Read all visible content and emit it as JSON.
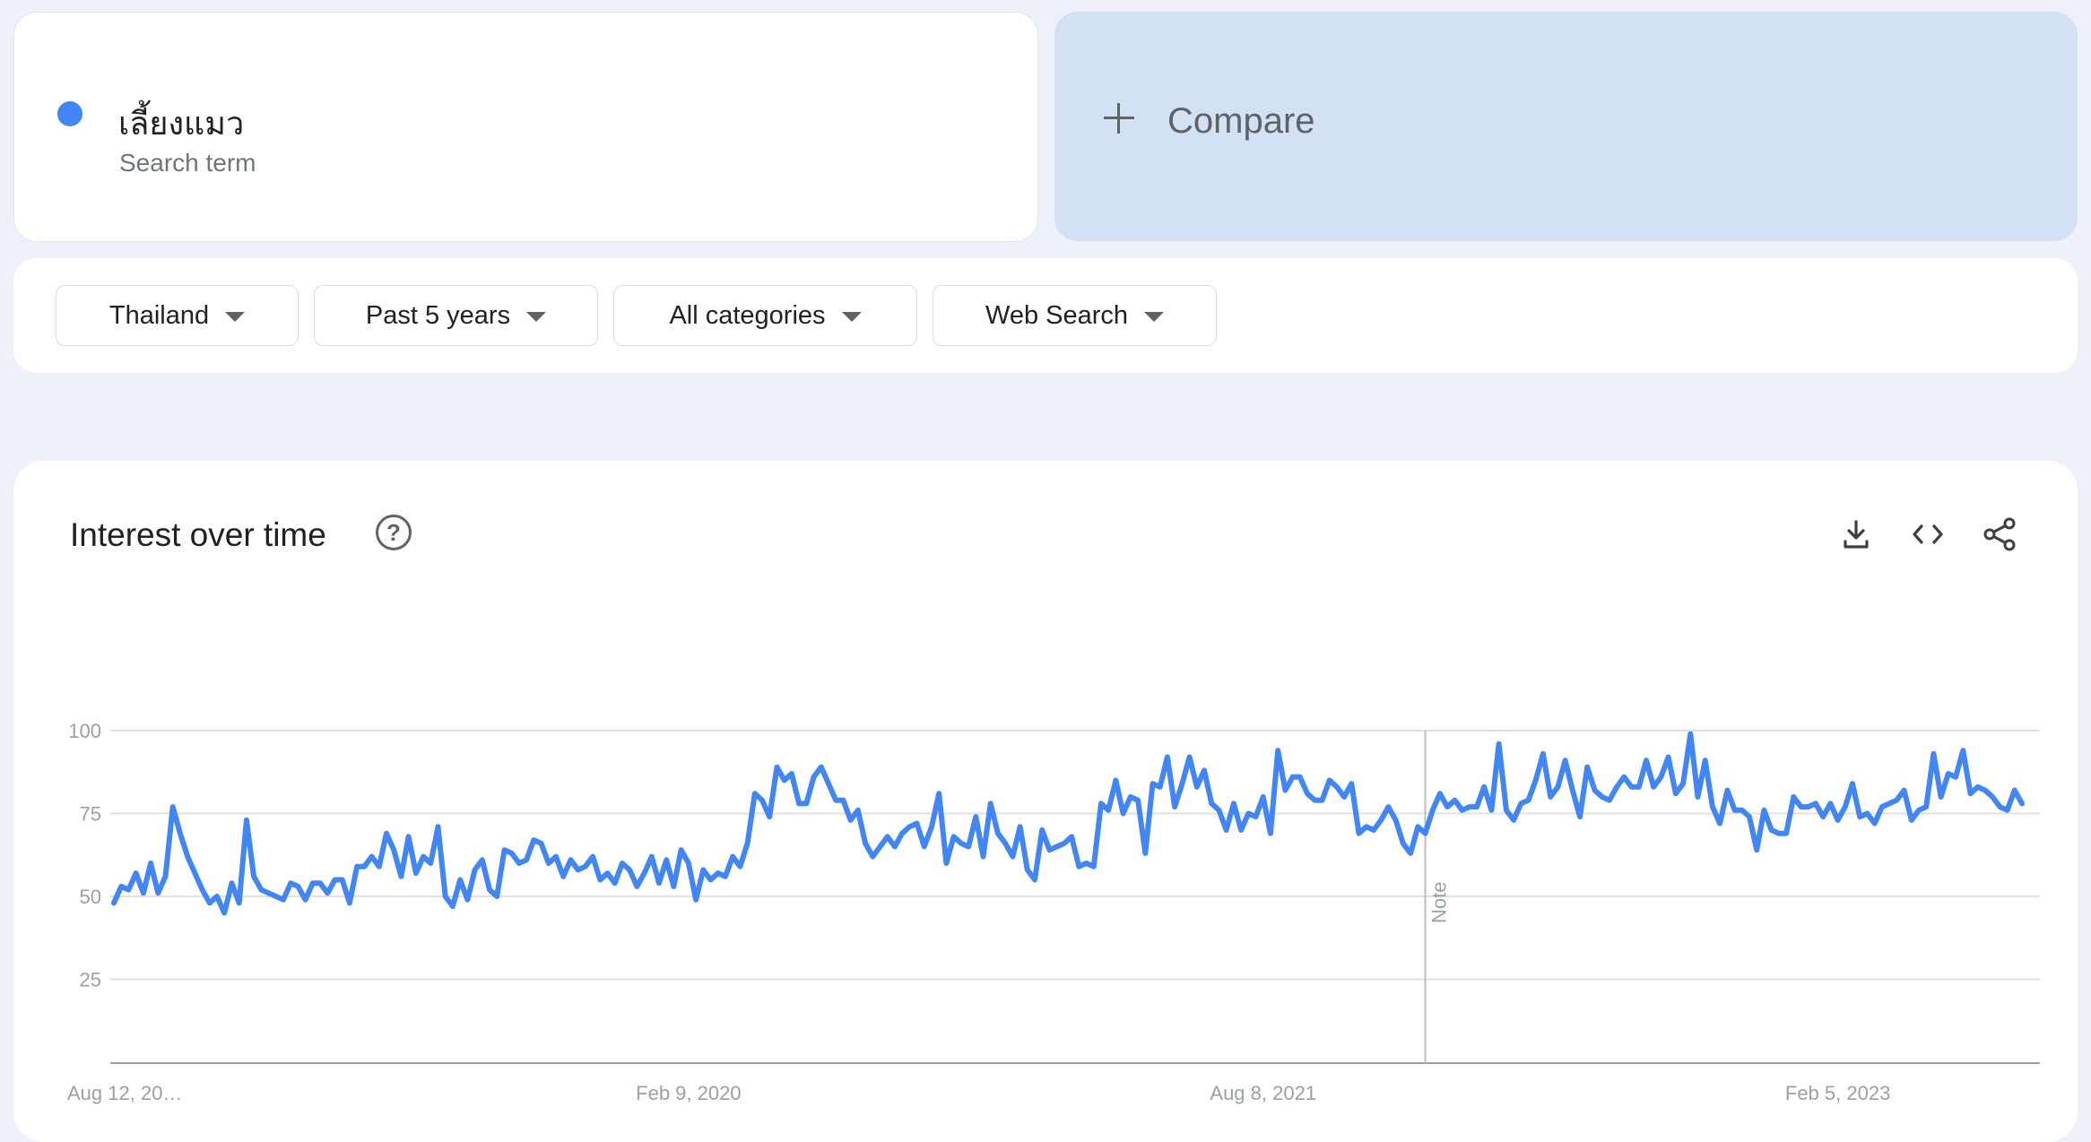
{
  "search_term": {
    "name": "เลี้ยงแมว",
    "subtitle": "Search term",
    "color": "#4285f4"
  },
  "compare": {
    "label": "Compare"
  },
  "filters": [
    {
      "label": "Thailand"
    },
    {
      "label": "Past 5 years"
    },
    {
      "label": "All categories"
    },
    {
      "label": "Web Search"
    }
  ],
  "panel": {
    "title": "Interest over time",
    "help_icon": "help-circle-icon",
    "tools": [
      "download-icon",
      "embed-code-icon",
      "share-icon"
    ]
  },
  "chart_data": {
    "type": "line",
    "title": "Interest over time",
    "xlabel": "",
    "ylabel": "",
    "ylim": [
      0,
      100
    ],
    "yticks": [
      25,
      50,
      75,
      100
    ],
    "grid": true,
    "legend": "none",
    "line_color": "#4285f4",
    "x_range": [
      "Aug 12, 2018",
      "Aug 6, 2023"
    ],
    "x_tick_labels": [
      {
        "label": "Aug 12, 20…",
        "date": "2018-08-12"
      },
      {
        "label": "Feb 9, 2020",
        "date": "2020-02-09"
      },
      {
        "label": "Aug 8, 2021",
        "date": "2021-08-08"
      },
      {
        "label": "Feb 5, 2023",
        "date": "2023-02-05"
      }
    ],
    "annotations": [
      {
        "label": "Note",
        "date": "2022-01-09"
      }
    ],
    "series": [
      {
        "frequency": "weekly",
        "start": "2018-08-12",
        "values": [
          48,
          53,
          52,
          57,
          51,
          60,
          51,
          56,
          77,
          69,
          62,
          57,
          52,
          48,
          50,
          45,
          54,
          48,
          73,
          56,
          52,
          51,
          50,
          49,
          54,
          53,
          49,
          54,
          54,
          51,
          55,
          55,
          48,
          59,
          59,
          62,
          59,
          69,
          64,
          56,
          68,
          57,
          62,
          60,
          71,
          50,
          47,
          55,
          49,
          58,
          61,
          52,
          50,
          64,
          63,
          60,
          61,
          67,
          66,
          60,
          62,
          56,
          61,
          58,
          59,
          62,
          55,
          57,
          54,
          60,
          58,
          53,
          57,
          62,
          54,
          61,
          53,
          64,
          60,
          49,
          58,
          55,
          57,
          56,
          62,
          59,
          66,
          81,
          79,
          74,
          89,
          85,
          87,
          78,
          78,
          86,
          89,
          84,
          79,
          79,
          73,
          76,
          66,
          62,
          65,
          68,
          65,
          69,
          71,
          72,
          65,
          71,
          81,
          60,
          68,
          66,
          65,
          74,
          62,
          78,
          69,
          66,
          62,
          71,
          58,
          55,
          70,
          64,
          65,
          66,
          68,
          59,
          60,
          59,
          78,
          76,
          85,
          75,
          80,
          79,
          63,
          84,
          83,
          92,
          77,
          84,
          92,
          83,
          88,
          78,
          76,
          70,
          78,
          70,
          75,
          74,
          80,
          69,
          94,
          82,
          86,
          86,
          81,
          79,
          79,
          85,
          83,
          80,
          84,
          69,
          71,
          70,
          73,
          77,
          73,
          66,
          63,
          71,
          69,
          76,
          81,
          77,
          79,
          76,
          77,
          77,
          83,
          76,
          96,
          76,
          73,
          78,
          79,
          85,
          93,
          80,
          83,
          91,
          82,
          74,
          89,
          82,
          80,
          79,
          83,
          86,
          83,
          83,
          91,
          83,
          86,
          92,
          81,
          84,
          99,
          80,
          91,
          77,
          72,
          82,
          76,
          76,
          74,
          64,
          76,
          70,
          69,
          69,
          80,
          77,
          77,
          78,
          74,
          78,
          73,
          77,
          84,
          74,
          75,
          72,
          77,
          78,
          79,
          82,
          73,
          76,
          77,
          93,
          80,
          87,
          86,
          94,
          81,
          83,
          82,
          80,
          77,
          76,
          82,
          78
        ]
      }
    ]
  }
}
